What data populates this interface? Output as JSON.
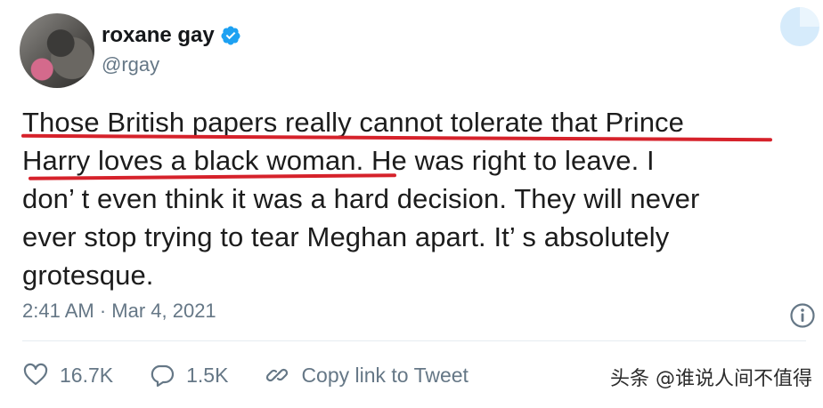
{
  "author": {
    "display_name": "roxane gay",
    "handle": "@rgay",
    "verified": true
  },
  "tweet": {
    "lines": [
      "Those British papers really cannot tolerate that Prince",
      "Harry loves a black woman. He was right to leave. I",
      "don’ t even think it was a hard decision. They will never",
      "ever stop trying to tear Meghan apart. It’ s absolutely",
      "grotesque."
    ],
    "timestamp": "2:41 AM · Mar 4, 2021"
  },
  "actions": {
    "likes": "16.7K",
    "replies": "1.5K",
    "copy_link_label": "Copy link to Tweet"
  },
  "watermark": "头条 @谁说人间不值得",
  "colors": {
    "verified": "#1da1f2",
    "highlight_underline": "#d6222b",
    "secondary_text": "#657786"
  },
  "icons": [
    "verified-badge-icon",
    "twitter-corner-icon",
    "info-icon",
    "heart-icon",
    "reply-icon",
    "link-icon"
  ]
}
